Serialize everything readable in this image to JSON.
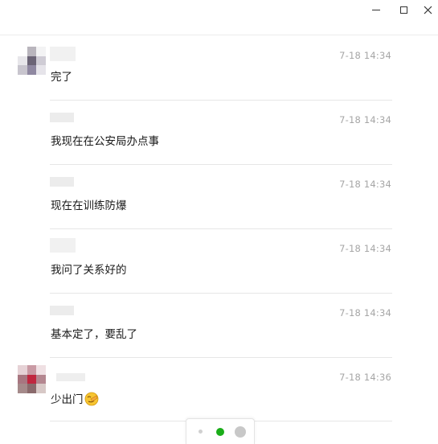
{
  "window": {
    "controls": {
      "minimize": "minimize-icon",
      "maximize": "maximize-icon",
      "close": "close-icon"
    }
  },
  "messages": [
    {
      "time": "7-18 14:34",
      "text": "完了",
      "has_avatar": true
    },
    {
      "time": "7-18 14:34",
      "text": "我现在在公安局办点事",
      "has_avatar": false
    },
    {
      "time": "7-18 14:34",
      "text": "现在在训练防爆",
      "has_avatar": false
    },
    {
      "time": "7-18 14:34",
      "text": "我问了关系好的",
      "has_avatar": false
    },
    {
      "time": "7-18 14:34",
      "text": "基本定了，要乱了",
      "has_avatar": false
    },
    {
      "time": "7-18 14:36",
      "text": "少出门",
      "has_avatar": true,
      "emoji": "facepalm-emoji"
    }
  ],
  "pager": {
    "pages": 3,
    "active_page": 2,
    "colors": {
      "active": "#1aad19",
      "inactive": "#c8c8c8"
    }
  }
}
